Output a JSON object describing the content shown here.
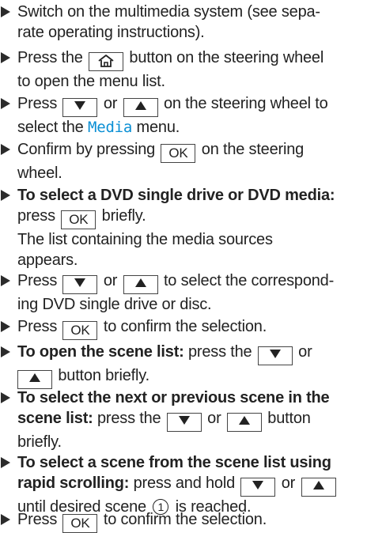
{
  "steps": [
    {
      "lines": [
        "Switch on the multimedia system (see sepa-",
        "rate operating instructions)."
      ]
    },
    {
      "a": "Press the",
      "b": "button on the steering wheel",
      "c": "to open the menu list."
    },
    {
      "a": "Press",
      "or": "or",
      "b": "on the steering wheel to",
      "c": "select the",
      "menu": "Media",
      "d": "menu."
    },
    {
      "a": "Confirm by pressing",
      "ok": "OK",
      "b": "on the steering",
      "c": "wheel."
    },
    {
      "bold": "To select a DVD single drive or DVD media:",
      "a": "press",
      "ok": "OK",
      "b": "briefly.",
      "c": "The list containing the media sources",
      "d": "appears."
    },
    {
      "a": "Press",
      "or": "or",
      "b": "to select the correspond-",
      "c": "ing DVD single drive or disc."
    },
    {
      "a": "Press",
      "ok": "OK",
      "b": "to confirm the selection."
    },
    {
      "bold": "To open the scene list:",
      "a": "press the",
      "or": "or",
      "b": "button briefly."
    },
    {
      "bold1": "To select the next or previous scene in the",
      "bold2": "scene list:",
      "a": "press the",
      "or": "or",
      "b": "button",
      "c": "briefly."
    },
    {
      "bold1": "To select a scene from the scene list using",
      "bold2": "rapid scrolling:",
      "a": "press and hold",
      "or": "or",
      "b": "until desired scene",
      "num": "1",
      "c": "is reached."
    },
    {
      "a": "Press",
      "ok": "OK",
      "b": "to confirm the selection."
    }
  ],
  "icons": {
    "step_marker": "arrow-right-triangle",
    "home": "home-icon",
    "down": "down-triangle-icon",
    "up": "up-triangle-icon"
  },
  "colors": {
    "menu_text": "#0a8fd4",
    "text": "#222222"
  }
}
